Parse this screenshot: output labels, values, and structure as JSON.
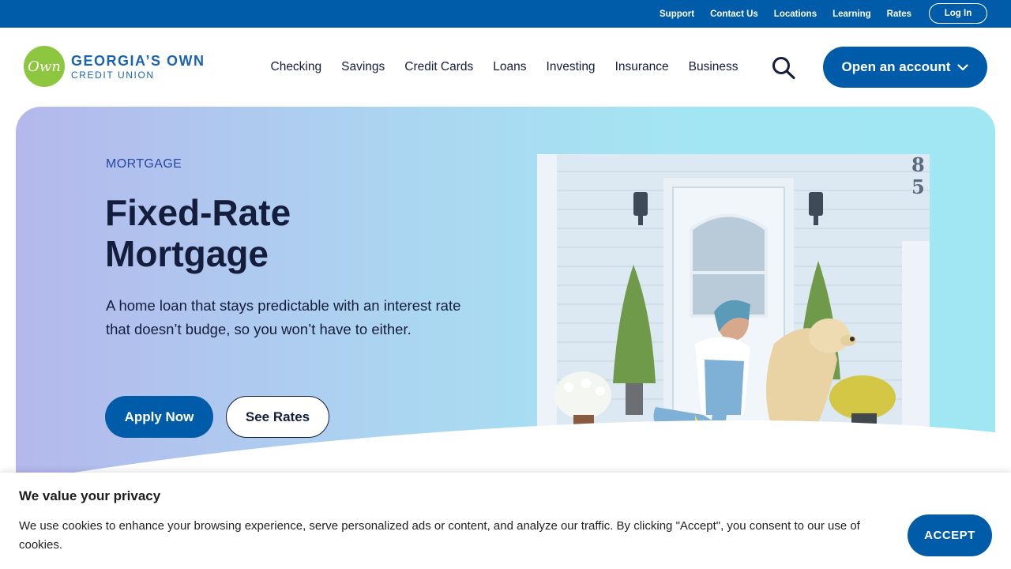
{
  "utility_nav": {
    "links": [
      "Support",
      "Contact Us",
      "Locations",
      "Learning",
      "Rates"
    ],
    "login_label": "Log In"
  },
  "brand": {
    "logo_mark": "Own",
    "name_line1": "GEORGIA’S OWN",
    "name_line2": "CREDIT UNION"
  },
  "main_nav": {
    "items": [
      "Checking",
      "Savings",
      "Credit Cards",
      "Loans",
      "Investing",
      "Insurance",
      "Business"
    ],
    "search_icon": "search-icon",
    "cta_label": "Open an account"
  },
  "hero": {
    "eyebrow": "MORTGAGE",
    "title_line1": "Fixed-Rate",
    "title_line2": "Mortgage",
    "description": "A home loan that stays predictable with an interest rate that doesn’t budge, so you won’t have to either.",
    "primary_cta": "Apply Now",
    "secondary_cta": "See Rates",
    "photo_house_number_1": "8",
    "photo_house_number_2": "5"
  },
  "cookie_banner": {
    "title": "We value your privacy",
    "text": "We use cookies to enhance your browsing experience, serve personalized ads or content, and analyze our traffic. By clicking \"Accept\", you consent to our use of cookies.",
    "accept_label": "ACCEPT"
  },
  "colors": {
    "brand_blue": "#005ca9",
    "logo_green": "#8dc63f",
    "text_dark": "#141d3c"
  }
}
